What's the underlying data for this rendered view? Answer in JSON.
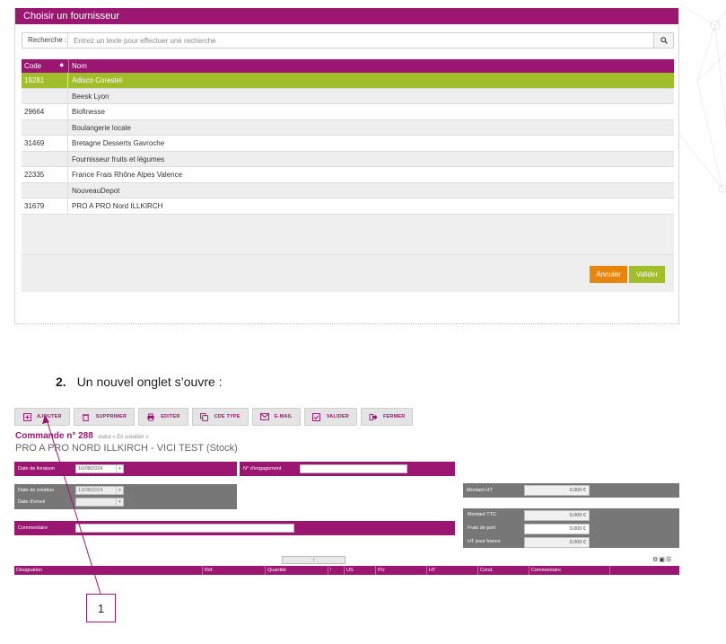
{
  "dialog": {
    "title": "Choisir un fournisseur",
    "search_label": "Recherche :",
    "search_placeholder": "Entrez un texte pour effectuer une recherche",
    "columns": {
      "code": "Code",
      "nom": "Nom"
    },
    "rows": [
      {
        "code": "19281",
        "nom": "Adisco Corestel",
        "selected": true
      },
      {
        "code": "",
        "nom": "Beesk Lyon"
      },
      {
        "code": "29664",
        "nom": "Biofinesse"
      },
      {
        "code": "",
        "nom": "Boulangerie locale"
      },
      {
        "code": "31469",
        "nom": "Bretagne Desserts Gavroche"
      },
      {
        "code": "",
        "nom": "Fournisseur fruits et légumes"
      },
      {
        "code": "22335",
        "nom": "France Frais Rhône Alpes Valence"
      },
      {
        "code": "",
        "nom": "NouveauDepot"
      },
      {
        "code": "31679",
        "nom": "PRO A PRO Nord ILLKIRCH"
      }
    ],
    "cancel_label": "Annuler",
    "validate_label": "Valider"
  },
  "step": {
    "number": "2.",
    "text": "Un nouvel onglet s’ouvre :"
  },
  "order": {
    "toolbar": [
      {
        "name": "ajouter",
        "label": "AJOUTER",
        "icon": "plus-square-icon"
      },
      {
        "name": "supprimer",
        "label": "SUPPRIMER",
        "icon": "trash-icon"
      },
      {
        "name": "editer",
        "label": "EDITER",
        "icon": "printer-icon"
      },
      {
        "name": "cde-type",
        "label": "CDE TYPE",
        "icon": "copy-icon"
      },
      {
        "name": "email",
        "label": "E-MAIL",
        "icon": "envelope-icon"
      },
      {
        "name": "valider",
        "label": "VALIDER",
        "icon": "check-square-icon"
      },
      {
        "name": "fermer",
        "label": "FERMER",
        "icon": "sign-out-icon"
      }
    ],
    "title": "Commande n° 288",
    "status": "statut « En création »",
    "subtitle": "PRO A PRO NORD ILLKIRCH - VICI TEST (Stock)",
    "date_livraison_label": "Date de livraison",
    "date_livraison": "16/08/2024",
    "engagement_label": "N° d'engagement",
    "engagement_value": "",
    "date_creation_label": "Date de création",
    "date_creation": "13/08/2024",
    "date_envoi_label": "Date d'envoi",
    "date_envoi": "",
    "commentaire_label": "Commentaire",
    "commentaire_value": "",
    "montant_ht_label": "Montant HT",
    "montant_ht": "0,000 €",
    "montant_ttc_label": "Montant TTC",
    "montant_ttc": "0,000 €",
    "frais_port_label": "Frais de port",
    "frais_port": "0,000 €",
    "ht_franco_label": "HT pour franco",
    "ht_franco": "0,000 €",
    "up_arrow": "↑",
    "grid_columns": [
      "Désignation",
      "Réf.",
      "Quantité",
      "!",
      "US",
      "PU",
      "HT",
      "Cond.",
      "Commentaire"
    ]
  },
  "callout": {
    "label": "1"
  },
  "colors": {
    "brand": "#9b1670",
    "selected_row": "#9fbe2a",
    "cancel": "#e8860c",
    "grey_bar": "#777777"
  }
}
